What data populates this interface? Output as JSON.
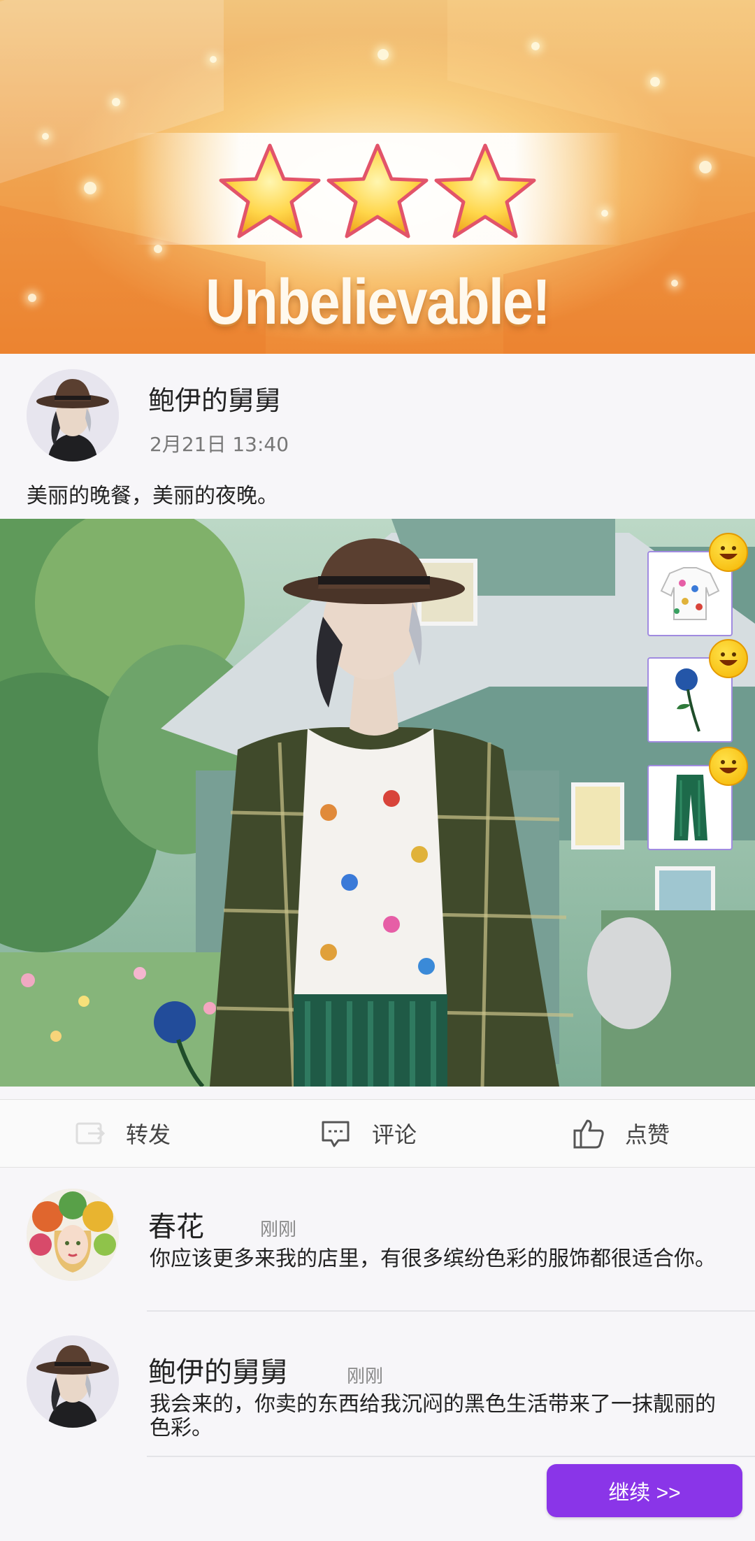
{
  "result": {
    "stars_earned": 3,
    "stars_total": 3,
    "headline": "Unbelievable!"
  },
  "post": {
    "author": "鲍伊的舅舅",
    "time": "2月21日 13:40",
    "text": "美丽的晚餐，美丽的夜晚。",
    "items": [
      {
        "icon": "butterfly-shirt-icon",
        "reaction": "grinning-emoji-icon"
      },
      {
        "icon": "blue-rose-icon",
        "reaction": "grinning-emoji-icon"
      },
      {
        "icon": "green-trousers-icon",
        "reaction": "grinning-emoji-icon"
      }
    ]
  },
  "actions": {
    "share": {
      "label": "转发",
      "icon": "share-icon"
    },
    "comment": {
      "label": "评论",
      "icon": "comment-icon"
    },
    "like": {
      "label": "点赞",
      "icon": "thumbs-up-icon"
    }
  },
  "comments": [
    {
      "name": "春花",
      "time": "刚刚",
      "text": "你应该更多来我的店里，有很多缤纷色彩的服饰都很适合你。"
    },
    {
      "name": "鲍伊的舅舅",
      "time": "刚刚",
      "text": "我会来的，你卖的东西给我沉闷的黑色生活带来了一抹靓丽的色彩。"
    }
  ],
  "continue_label": "继续 >>",
  "colors": {
    "accent": "#8a35e8",
    "card_border": "#a08be0",
    "star_fill": "#ffd64a",
    "star_outline": "#e2546a"
  }
}
